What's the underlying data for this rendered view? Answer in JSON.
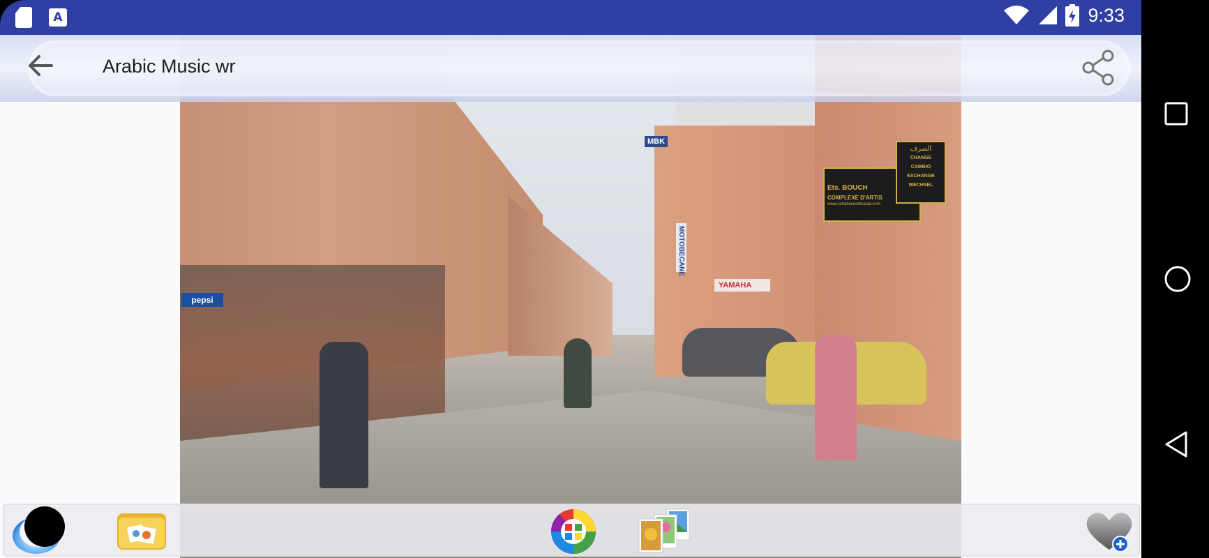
{
  "status_bar": {
    "time": "9:33",
    "left_icons": [
      "sd-card-icon",
      "a-app-icon"
    ],
    "right_icons": [
      "wifi-icon",
      "signal-icon",
      "battery-charging-icon"
    ]
  },
  "toolbar": {
    "title": "Arabic Music wr",
    "back_icon": "arrow-left-icon",
    "share_icon": "share-icon"
  },
  "photo": {
    "signs": {
      "mbk": "MBK",
      "yamaha": "YAMAHA",
      "motobecane": "MOTOBECANE",
      "ets": "Ets. BOUCH",
      "complexe": "COMPLEXE D'ARTIS",
      "website": "www.complexeartisanal.com",
      "exchange_arabic": "الصرف",
      "exchange_lines": [
        "CHANGE",
        "CAMBIO",
        "EXCHANGE",
        "WECHSEL"
      ],
      "pepsi": "pepsi"
    }
  },
  "dock": {
    "items": [
      "blue-ring-icon",
      "folder-photos-icon",
      "color-wheel-icon",
      "photo-stack-icon",
      "heart-add-icon"
    ]
  },
  "nav_bar": {
    "buttons": [
      "recents-square-icon",
      "home-circle-icon",
      "back-triangle-icon"
    ]
  },
  "colors": {
    "status_bar": "#2f3fa3",
    "toolbar": "#dce2f6",
    "background": "#fafafa"
  }
}
